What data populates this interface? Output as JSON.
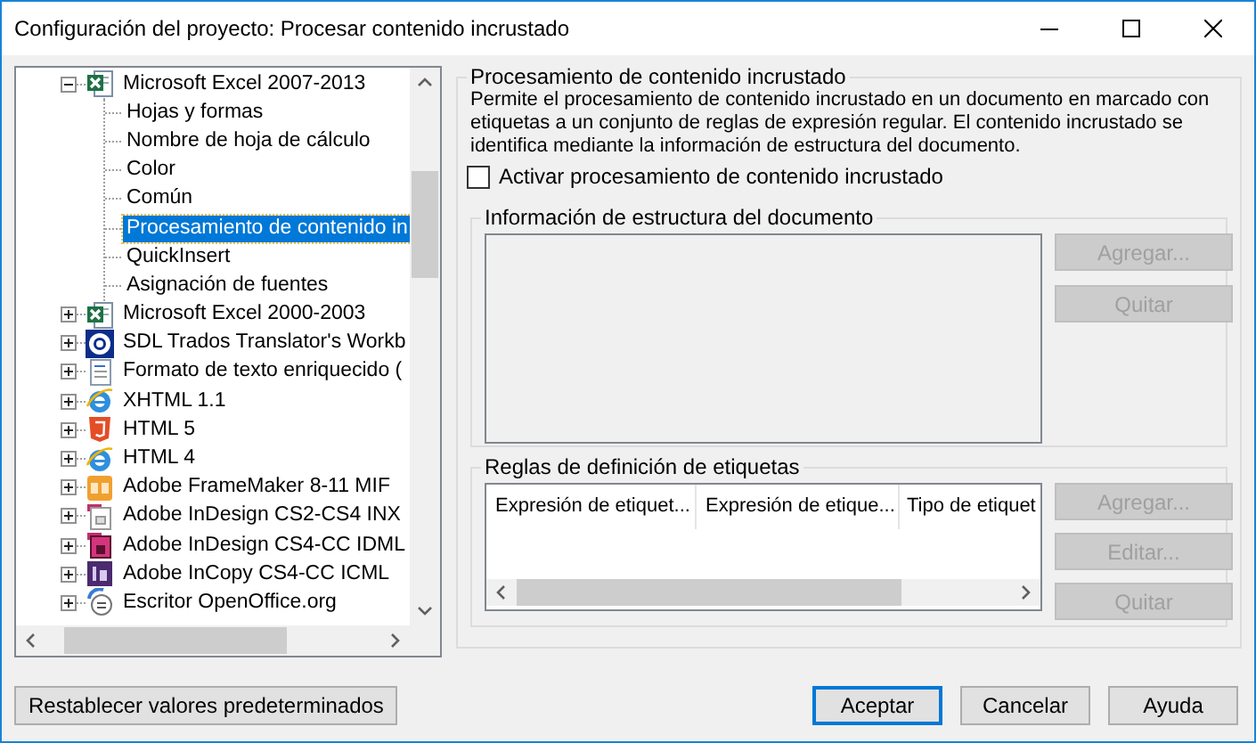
{
  "window": {
    "title": "Configuración del proyecto: Procesar contenido incrustado"
  },
  "tree": {
    "items": [
      {
        "label": "Microsoft Excel 2007-2013",
        "kind": "excel",
        "expanded": true,
        "selected": false,
        "children": [
          {
            "label": "Hojas y formas",
            "selected": false
          },
          {
            "label": "Nombre de hoja de cálculo",
            "selected": false
          },
          {
            "label": "Color",
            "selected": false
          },
          {
            "label": "Común",
            "selected": false
          },
          {
            "label": "Procesamiento de contenido in",
            "selected": true
          },
          {
            "label": "QuickInsert",
            "selected": false
          },
          {
            "label": "Asignación de fuentes",
            "selected": false
          }
        ]
      },
      {
        "label": "Microsoft Excel 2000-2003",
        "kind": "excel",
        "expanded": false,
        "selected": false
      },
      {
        "label": "SDL Trados Translator's Workb",
        "kind": "ring",
        "expanded": false,
        "selected": false
      },
      {
        "label": "Formato de texto enriquecido (",
        "kind": "doc",
        "expanded": false,
        "selected": false
      },
      {
        "label": "XHTML 1.1",
        "kind": "globe",
        "expanded": false,
        "selected": false
      },
      {
        "label": "HTML 5",
        "kind": "shield",
        "expanded": false,
        "selected": false
      },
      {
        "label": "HTML 4",
        "kind": "globe",
        "expanded": false,
        "selected": false
      },
      {
        "label": "Adobe FrameMaker 8-11 MIF",
        "kind": "orange-tile",
        "expanded": false,
        "selected": false
      },
      {
        "label": "Adobe InDesign CS2-CS4 INX",
        "kind": "page",
        "expanded": false,
        "selected": false
      },
      {
        "label": "Adobe InDesign CS4-CC IDML",
        "kind": "pink-page",
        "expanded": false,
        "selected": false
      },
      {
        "label": "Adobe InCopy CS4-CC ICML",
        "kind": "purple-tile",
        "expanded": false,
        "selected": false
      },
      {
        "label": "Escritor OpenOffice.org",
        "kind": "round-doc",
        "expanded": false,
        "selected": false
      }
    ]
  },
  "section": {
    "title": "Procesamiento de contenido incrustado",
    "description": "Permite el procesamiento de contenido incrustado en un documento en marcado con etiquetas a un conjunto de reglas de expresión regular. El contenido incrustado se identifica mediante la información de estructura del documento.",
    "checkbox": {
      "label": "Activar procesamiento de contenido incrustado",
      "checked": false
    },
    "structure": {
      "title": "Información de estructura del documento",
      "buttons": [
        {
          "label": "Agregar...",
          "disabled": true
        },
        {
          "label": "Quitar",
          "disabled": true
        }
      ]
    },
    "rules": {
      "title": "Reglas de definición de etiquetas",
      "columns": [
        "Expresión de etiquet...",
        "Expresión de etique...",
        "Tipo de etiquet"
      ],
      "buttons": [
        {
          "label": "Agregar...",
          "disabled": true
        },
        {
          "label": "Editar...",
          "disabled": true
        },
        {
          "label": "Quitar",
          "disabled": true
        }
      ]
    }
  },
  "footer": {
    "reset": "Restablecer valores predeterminados",
    "buttons": [
      {
        "label": "Aceptar",
        "default": true
      },
      {
        "label": "Cancelar",
        "default": false
      },
      {
        "label": "Ayuda",
        "default": false
      }
    ]
  }
}
